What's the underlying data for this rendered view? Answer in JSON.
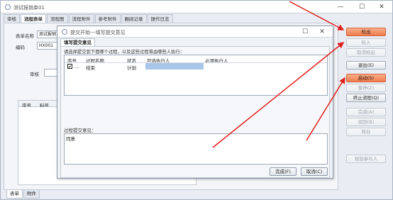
{
  "window": {
    "title": "测试报销单01",
    "min": "—",
    "max": "☐",
    "close": "✕"
  },
  "tabs": [
    "审核",
    "流程表单",
    "流程图",
    "流程附件",
    "参考附件",
    "圈阅记录",
    "操作日志"
  ],
  "form": {
    "biz_label": "表单名称",
    "biz_value": "测试报销",
    "code_label": "编码",
    "code_value": "HX001",
    "audit_label": "审核",
    "col_index": "序号",
    "col_item": "料号"
  },
  "bottom_tabs": [
    "表单",
    "附件"
  ],
  "right_buttons": [
    {
      "label": "检出",
      "state": "orange"
    },
    {
      "label": "检入",
      "state": "disabled"
    },
    {
      "label": "取消检出",
      "state": "disabled"
    },
    {
      "label": "退出(E)",
      "state": "normal"
    },
    {
      "label": "启动(S)",
      "state": "orange"
    },
    {
      "label": "暂停(Z)",
      "state": "disabled"
    },
    {
      "label": "终止流程(Q)",
      "state": "normal"
    },
    {
      "label": "完成(A)",
      "state": "disabled"
    },
    {
      "label": "驳回(B)",
      "state": "disabled"
    },
    {
      "label": "转办",
      "state": "disabled"
    },
    {
      "label": "规划参与人",
      "state": "disabled"
    }
  ],
  "dialog": {
    "title": "提交开始---填写提交意见",
    "tab": "填写提交意见",
    "instruction": "请选择提交到下面哪个过程，以及这些过程将由哪些人执行：",
    "columns": [
      "序号",
      "过程名称",
      "状态",
      "可选执行人",
      "必须执行人"
    ],
    "rows": [
      {
        "index": "...",
        "checked": true,
        "name": "结束",
        "status": "计划",
        "optional": "",
        "required": ""
      }
    ],
    "opinion_label": "过程提交意见：",
    "opinion_value": "同意",
    "ok_button": "完成(F)",
    "cancel_button": "取消(C)"
  },
  "colors": {
    "accent_orange": "#ef7b4c",
    "highlight_blue": "#a9c6ea",
    "arrow_red": "#e0201b"
  }
}
